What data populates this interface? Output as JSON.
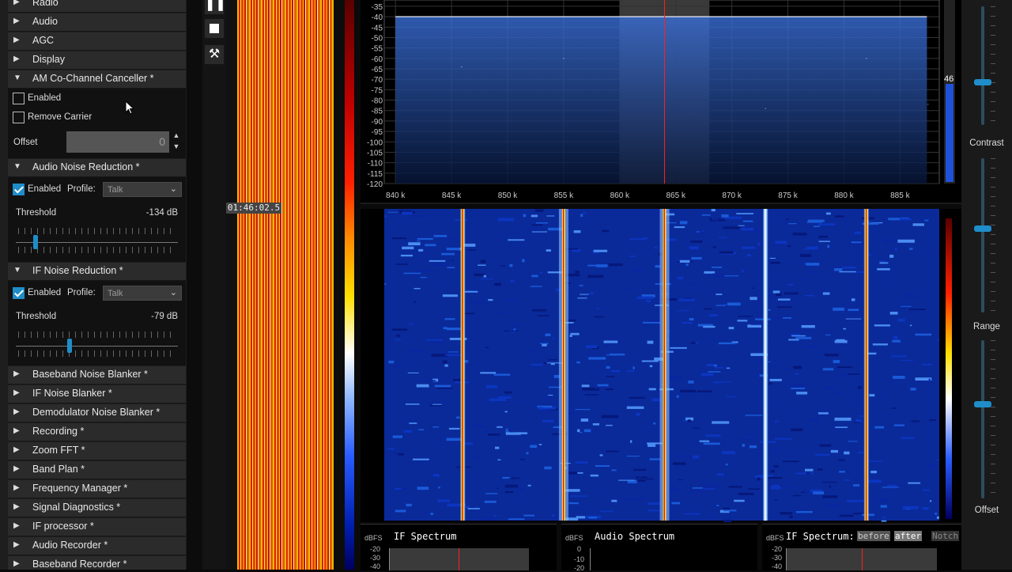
{
  "left_panel": {
    "sections_top": [
      {
        "label": "Radio",
        "expanded": false
      },
      {
        "label": "Audio",
        "expanded": false
      },
      {
        "label": "AGC",
        "expanded": false
      },
      {
        "label": "Display",
        "expanded": false
      },
      {
        "label": "AM Co-Channel Canceller *",
        "expanded": true
      }
    ],
    "am_cochannel": {
      "enabled_label": "Enabled",
      "enabled_checked": false,
      "remove_carrier_label": "Remove Carrier",
      "remove_carrier_checked": false,
      "offset_label": "Offset",
      "offset_value": "0"
    },
    "audio_nr": {
      "header": "Audio Noise Reduction *",
      "enabled_label": "Enabled",
      "enabled_checked": true,
      "profile_label": "Profile:",
      "profile_value": "Talk",
      "threshold_label": "Threshold",
      "threshold_value": "-134 dB",
      "threshold_fraction": 0.12
    },
    "if_nr": {
      "header": "IF Noise Reduction *",
      "enabled_label": "Enabled",
      "enabled_checked": true,
      "profile_label": "Profile:",
      "profile_value": "Talk",
      "threshold_label": "Threshold",
      "threshold_value": "-79 dB",
      "threshold_fraction": 0.33
    },
    "sections_bottom": [
      {
        "label": "Baseband Noise Blanker *"
      },
      {
        "label": "IF Noise Blanker *"
      },
      {
        "label": "Demodulator Noise Blanker *"
      },
      {
        "label": "Recording *"
      },
      {
        "label": "Zoom FFT *"
      },
      {
        "label": "Band Plan *"
      },
      {
        "label": "Frequency Manager *"
      },
      {
        "label": "Signal Diagnostics *"
      },
      {
        "label": "IF processor *"
      },
      {
        "label": "Audio Recorder *"
      },
      {
        "label": "Baseband Recorder *"
      }
    ]
  },
  "toolbar": {
    "pause_icon": "pause-icon",
    "stop_icon": "stop-icon",
    "tools_icon": "tools-icon"
  },
  "timestamp": "01:46:02.5",
  "chart_data": {
    "type": "line",
    "x_unit": "kHz",
    "x_tick_labels": [
      "840 k",
      "845 k",
      "850 k",
      "855 k",
      "860 k",
      "865 k",
      "870 k",
      "875 k",
      "880 k",
      "885 k"
    ],
    "x_ticks": [
      840,
      845,
      850,
      855,
      860,
      865,
      870,
      875,
      880,
      885
    ],
    "xlim": [
      839,
      888.5
    ],
    "y_tick_labels": [
      "-35",
      "-40",
      "-45",
      "-50",
      "-55",
      "-60",
      "-65",
      "-70",
      "-75",
      "-80",
      "-85",
      "-90",
      "-95",
      "-100",
      "-105",
      "-110",
      "-115",
      "-120"
    ],
    "ylim": [
      -120,
      -32
    ],
    "noise_floor": -100,
    "peaks": [
      {
        "x": 845.9,
        "y": -64
      },
      {
        "x": 855.0,
        "y": -60
      },
      {
        "x": 864.0,
        "y": -52
      },
      {
        "x": 873.0,
        "y": -84
      },
      {
        "x": 882.0,
        "y": -60
      },
      {
        "x": 887.5,
        "y": -82
      }
    ],
    "filter_band": [
      860,
      868
    ],
    "tuned_freq": 864,
    "grid": true,
    "legend": "none"
  },
  "waterfall": {
    "carriers_khz": [
      846,
      855,
      864,
      873,
      882
    ]
  },
  "level_meter": {
    "value": "46",
    "fraction": 0.46
  },
  "right_panel": {
    "contrast_label": "Contrast",
    "range_label": "Range",
    "offset_label": "Offset"
  },
  "bottom": {
    "if_spectrum": {
      "unit": "dBFS",
      "title": "IF Spectrum",
      "ticks": [
        "-20",
        "-30",
        "-40"
      ]
    },
    "audio_spectrum": {
      "unit": "dBFS",
      "title": "Audio Spectrum",
      "ticks": [
        "0",
        "-10",
        "-20"
      ]
    },
    "if_spectrum_after": {
      "unit": "dBFS",
      "title": "IF Spectrum:",
      "btn_before": "before",
      "btn_after": "after",
      "btn_notch": "Notch",
      "ticks": [
        "-20",
        "-30",
        "-40"
      ]
    }
  },
  "colors": {
    "accent": "#1f8dc9",
    "spectrum_line": "#ffffff",
    "tuned_line": "#ff2020"
  }
}
